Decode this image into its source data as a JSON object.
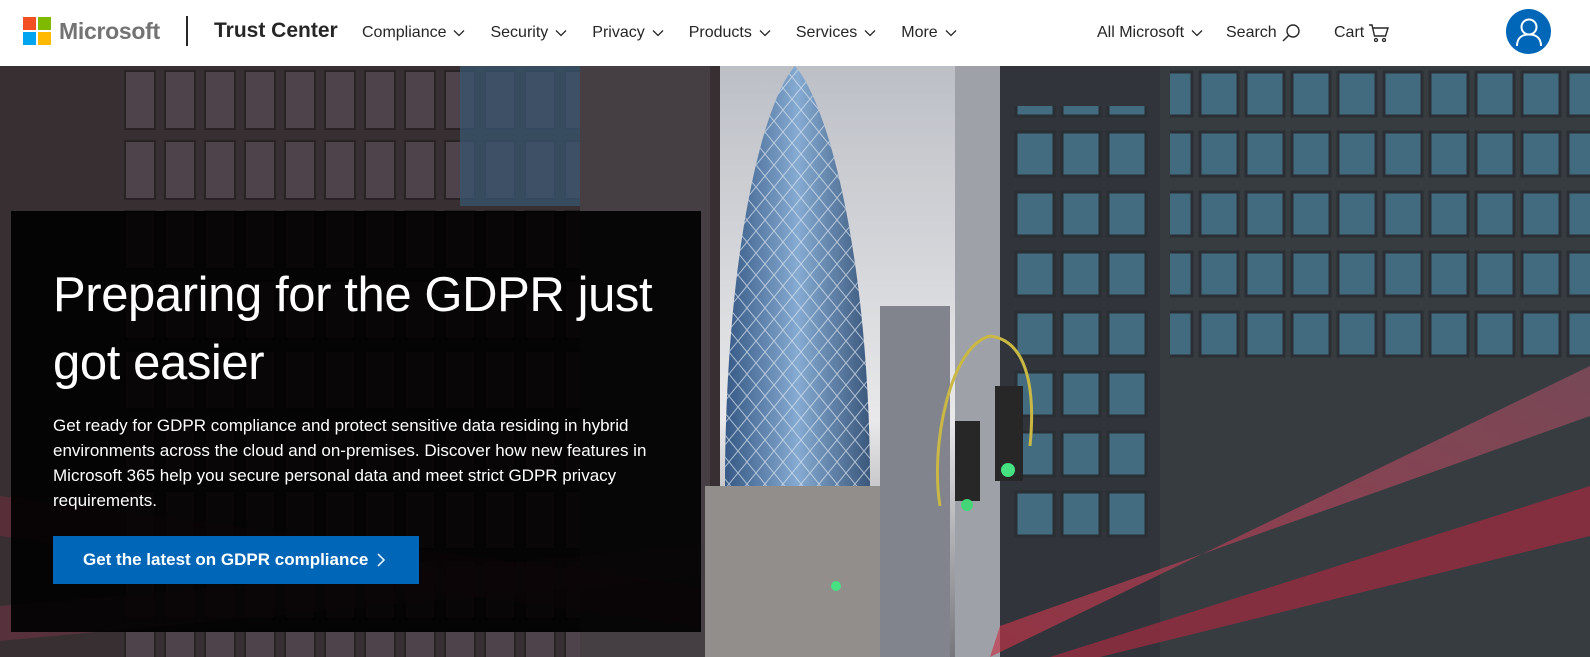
{
  "brand": {
    "logo_text": "Microsoft",
    "logo_colors": [
      "#f25022",
      "#7fba00",
      "#00a4ef",
      "#ffb900"
    ],
    "site_name": "Trust Center"
  },
  "nav": {
    "items": [
      {
        "label": "Compliance",
        "icon": "chevron-down-icon"
      },
      {
        "label": "Security",
        "icon": "chevron-down-icon"
      },
      {
        "label": "Privacy",
        "icon": "chevron-down-icon"
      },
      {
        "label": "Products",
        "icon": "chevron-down-icon"
      },
      {
        "label": "Services",
        "icon": "chevron-down-icon"
      },
      {
        "label": "More",
        "icon": "chevron-down-icon"
      }
    ]
  },
  "utility": {
    "all_microsoft": "All Microsoft",
    "search_label": "Search",
    "search_icon": "search-icon",
    "cart_label": "Cart",
    "cart_icon": "cart-icon",
    "avatar_icon": "user-icon"
  },
  "hero": {
    "title": "Preparing for the GDPR just got easier",
    "description": "Get ready for GDPR compliance and protect sensitive data residing in hybrid environments across the cloud and on-premises. Discover how new features in Microsoft 365 help you secure personal data and meet strict GDPR privacy requirements.",
    "cta_label": "Get the latest on GDPR compliance",
    "cta_icon": "chevron-right-icon"
  },
  "colors": {
    "accent": "#0067b8",
    "text": "#262626",
    "logo_gray": "#737373"
  }
}
